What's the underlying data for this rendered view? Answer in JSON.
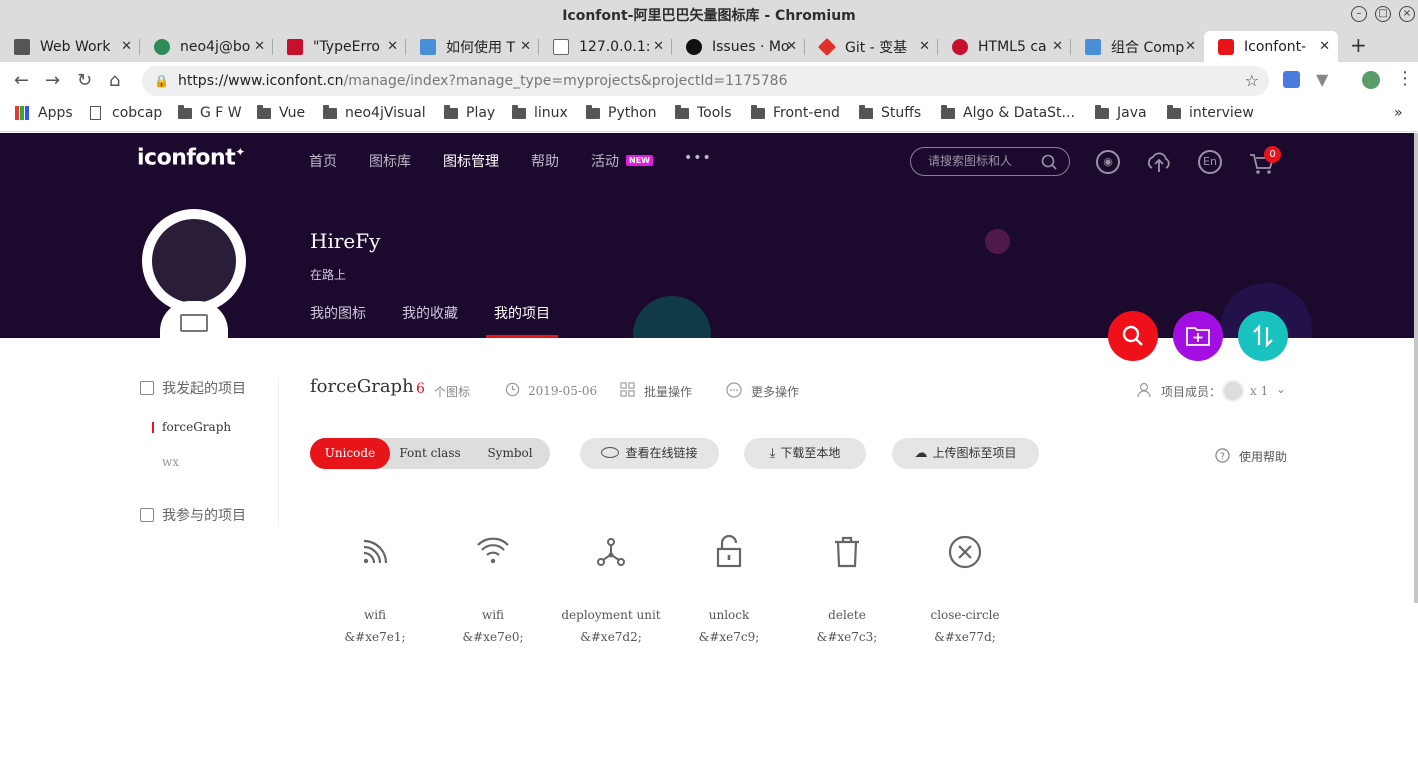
{
  "window": {
    "title": "Iconfont-阿里巴巴矢量图标库 - Chromium"
  },
  "tabs": [
    {
      "label": "Web Work",
      "color": "#555555"
    },
    {
      "label": "neo4j@bo",
      "color": "#2e8b57"
    },
    {
      "label": "\"TypeErro",
      "color": "#c8102e"
    },
    {
      "label": "如何使用 T",
      "color": "#4a90d9"
    },
    {
      "label": "127.0.0.1:",
      "color": "#888888"
    },
    {
      "label": "Issues · Mo",
      "color": "#111111"
    },
    {
      "label": "Git - 变基",
      "color": "#e0302a"
    },
    {
      "label": "HTML5 ca",
      "color": "#c8102e"
    },
    {
      "label": "组合 Comp",
      "color": "#4a90d9"
    },
    {
      "label": "Iconfont-",
      "color": "#e7141a"
    }
  ],
  "address": {
    "host": "https://www.iconfont.cn",
    "path": "/manage/index?manage_type=myprojects&projectId=1175786"
  },
  "bookmarks": [
    "Apps",
    "cobcap",
    "G F W",
    "Vue",
    "neo4jVisual",
    "Play",
    "linux",
    "Python",
    "Tools",
    "Front-end",
    "Stuffs",
    "Algo & DataSt...",
    "Java",
    "interview"
  ],
  "header": {
    "logo": "iconfont",
    "nav": [
      "首页",
      "图标库",
      "图标管理",
      "帮助",
      "活动"
    ],
    "new_badge": "NEW",
    "more": "•••",
    "search_placeholder": "请搜索图标和人",
    "lang": "En",
    "cart_count": "0"
  },
  "profile": {
    "name": "HireFy",
    "motto": "在路上",
    "tabs": [
      "我的图标",
      "我的收藏",
      "我的项目"
    ]
  },
  "sidebar": {
    "started_label": "我发起的项目",
    "projects": [
      "forceGraph",
      "wx"
    ],
    "joined_label": "我参与的项目"
  },
  "project": {
    "name": "forceGraph",
    "count": "6",
    "count_unit": "个图标",
    "date": "2019-05-06",
    "batch": "批量操作",
    "more_ops": "更多操作",
    "members_label": "项目成员：",
    "members_count": "x 1"
  },
  "buttons": {
    "modes": [
      "Unicode",
      "Font class",
      "Symbol"
    ],
    "view_link": "查看在线链接",
    "download": "下载至本地",
    "upload": "上传图标至项目",
    "help": "使用帮助"
  },
  "icons": [
    {
      "name": "wifi",
      "code": "&#xe7e1;",
      "icon": "rss-wifi-icon"
    },
    {
      "name": "wifi",
      "code": "&#xe7e0;",
      "icon": "wifi-icon"
    },
    {
      "name": "deployment unit",
      "code": "&#xe7d2;",
      "icon": "deployment-unit-icon"
    },
    {
      "name": "unlock",
      "code": "&#xe7c9;",
      "icon": "unlock-icon"
    },
    {
      "name": "delete",
      "code": "&#xe7c3;",
      "icon": "delete-icon"
    },
    {
      "name": "close-circle",
      "code": "&#xe77d;",
      "icon": "close-circle-icon"
    }
  ],
  "colors": {
    "brand": "#e7141a",
    "header_bg": "#1c0a2e",
    "fab_red": "#f0101a",
    "fab_purple": "#a20fe0",
    "fab_teal": "#17c2bf"
  }
}
